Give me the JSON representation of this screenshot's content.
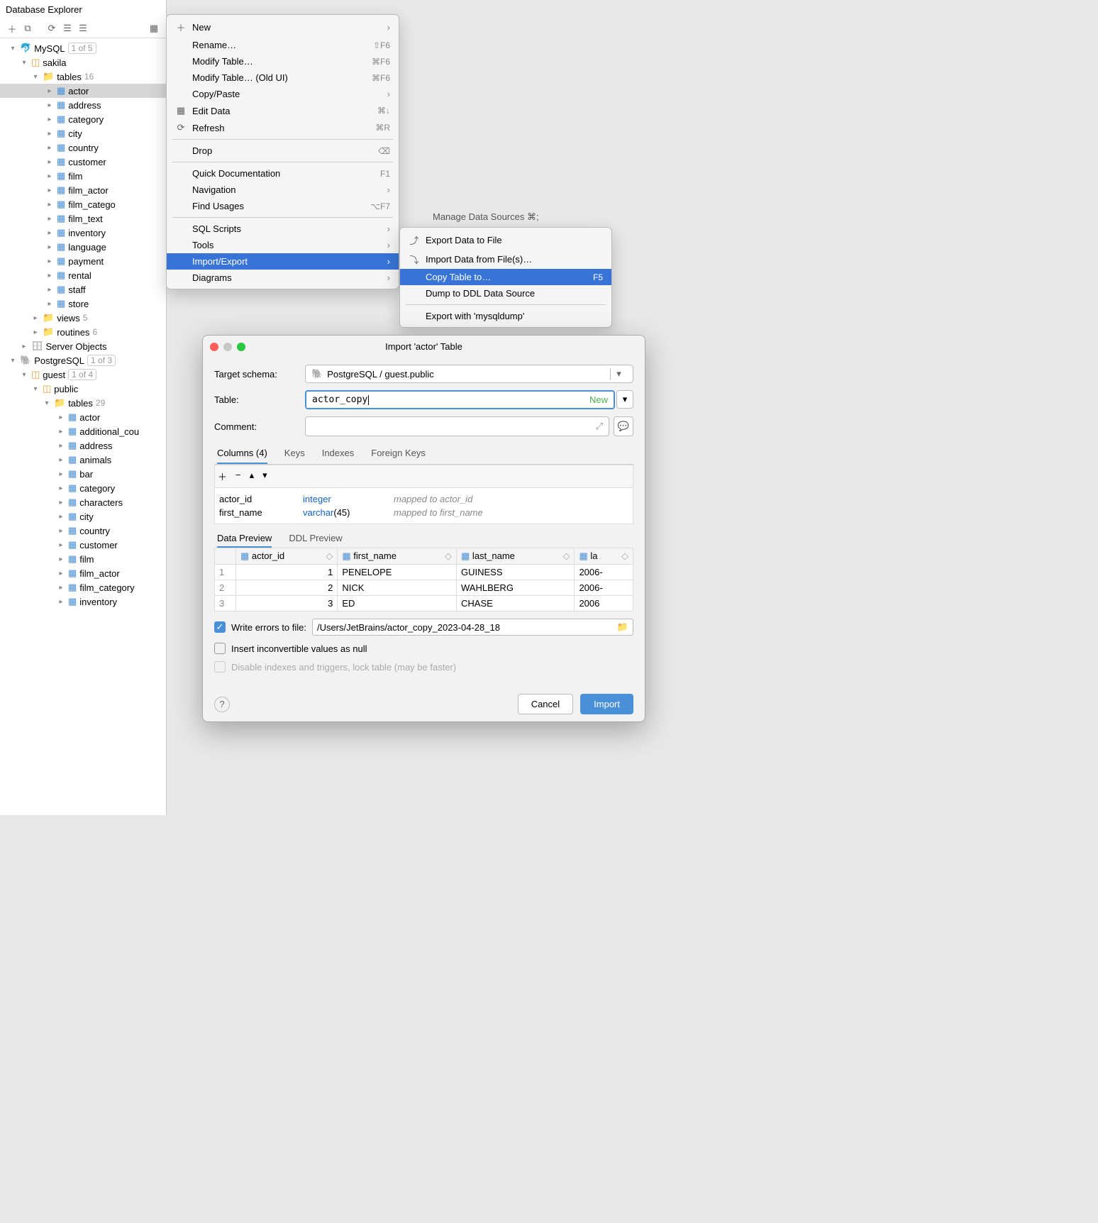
{
  "explorer": {
    "title": "Database Explorer"
  },
  "tree": {
    "mysql": {
      "label": "MySQL",
      "badge": "1 of 5"
    },
    "sakila": {
      "label": "sakila"
    },
    "tables_mysql": {
      "label": "tables",
      "count": "16"
    },
    "mysql_tables": [
      "actor",
      "address",
      "category",
      "city",
      "country",
      "customer",
      "film",
      "film_actor",
      "film_catego",
      "film_text",
      "inventory",
      "language",
      "payment",
      "rental",
      "staff",
      "store"
    ],
    "views": {
      "label": "views",
      "count": "5"
    },
    "routines": {
      "label": "routines",
      "count": "6"
    },
    "server_objects": {
      "label": "Server Objects"
    },
    "postgres": {
      "label": "PostgreSQL",
      "badge": "1 of 3"
    },
    "guest": {
      "label": "guest",
      "badge": "1 of 4"
    },
    "public": {
      "label": "public"
    },
    "tables_pg": {
      "label": "tables",
      "count": "29"
    },
    "pg_tables": [
      "actor",
      "additional_cou",
      "address",
      "animals",
      "bar",
      "category",
      "characters",
      "city",
      "country",
      "customer",
      "film",
      "film_actor",
      "film_category",
      "inventory"
    ]
  },
  "ctx": {
    "new": "New",
    "rename": "Rename…",
    "modify": "Modify Table…",
    "modify_old": "Modify Table… (Old UI)",
    "copy_paste": "Copy/Paste",
    "edit_data": "Edit Data",
    "refresh": "Refresh",
    "drop": "Drop",
    "quick_doc": "Quick Documentation",
    "navigation": "Navigation",
    "find_usages": "Find Usages",
    "sql_scripts": "SQL Scripts",
    "tools": "Tools",
    "import_export": "Import/Export",
    "diagrams": "Diagrams",
    "sc_rename": "⇧F6",
    "sc_modify": "⌘F6",
    "sc_modify_old": "⌘F6",
    "sc_edit": "⌘↓",
    "sc_refresh": "⌘R",
    "sc_quick": "F1",
    "sc_find": "⌥F7"
  },
  "manage": {
    "label": "Manage Data Sources ⌘;"
  },
  "sub": {
    "export_file": "Export Data to File",
    "import_file": "Import Data from File(s)…",
    "copy_table": "Copy Table to…",
    "copy_sc": "F5",
    "dump_ddl": "Dump to DDL Data Source",
    "export_mysqldump": "Export with 'mysqldump'"
  },
  "dlg": {
    "title": "Import 'actor' Table",
    "target_label": "Target schema:",
    "target_value": "PostgreSQL / guest.public",
    "table_label": "Table:",
    "table_value": "actor_copy",
    "new_tag": "New",
    "comment_label": "Comment:",
    "tab_columns": "Columns (4)",
    "tab_keys": "Keys",
    "tab_indexes": "Indexes",
    "tab_fk": "Foreign Keys",
    "cols": [
      {
        "name": "actor_id",
        "type": "integer",
        "map": "mapped to actor_id"
      },
      {
        "name": "first_name",
        "type": "varchar",
        "arg": "(45)",
        "map": "mapped to first_name"
      }
    ],
    "ptab_data": "Data Preview",
    "ptab_ddl": "DDL Preview",
    "headers": [
      "actor_id",
      "first_name",
      "last_name",
      "la"
    ],
    "rows": [
      {
        "n": "1",
        "c": [
          "1",
          "PENELOPE",
          "GUINESS",
          "2006-"
        ]
      },
      {
        "n": "2",
        "c": [
          "2",
          "NICK",
          "WAHLBERG",
          "2006-"
        ]
      },
      {
        "n": "3",
        "c": [
          "3",
          "ED",
          "CHASE",
          "2006"
        ]
      }
    ],
    "write_errors": "Write errors to file:",
    "errors_path": "/Users/JetBrains/actor_copy_2023-04-28_18",
    "insert_null": "Insert inconvertible values as null",
    "disable_idx": "Disable indexes and triggers, lock table (may be faster)",
    "cancel": "Cancel",
    "import": "Import"
  }
}
